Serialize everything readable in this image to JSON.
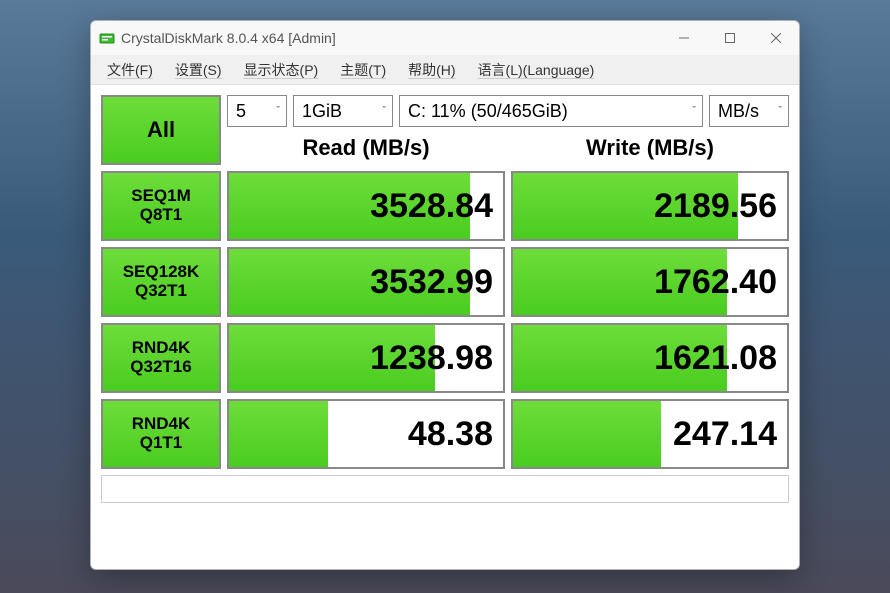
{
  "window": {
    "title": "CrystalDiskMark 8.0.4 x64 [Admin]"
  },
  "menu": {
    "file": "文件(F)",
    "settings": "设置(S)",
    "show_state": "显示状态(P)",
    "theme": "主题(T)",
    "help": "帮助(H)",
    "language": "语言(L)(Language)"
  },
  "controls": {
    "all_label": "All",
    "count": "5",
    "size": "1GiB",
    "target": "C: 11% (50/465GiB)",
    "unit": "MB/s"
  },
  "headers": {
    "read": "Read (MB/s)",
    "write": "Write (MB/s)"
  },
  "tests": [
    {
      "label1": "SEQ1M",
      "label2": "Q8T1",
      "read": "3528.84",
      "write": "2189.56",
      "read_pct": 88,
      "write_pct": 82
    },
    {
      "label1": "SEQ128K",
      "label2": "Q32T1",
      "read": "3532.99",
      "write": "1762.40",
      "read_pct": 88,
      "write_pct": 78
    },
    {
      "label1": "RND4K",
      "label2": "Q32T16",
      "read": "1238.98",
      "write": "1621.08",
      "read_pct": 75,
      "write_pct": 78
    },
    {
      "label1": "RND4K",
      "label2": "Q1T1",
      "read": "48.38",
      "write": "247.14",
      "read_pct": 36,
      "write_pct": 54
    }
  ]
}
